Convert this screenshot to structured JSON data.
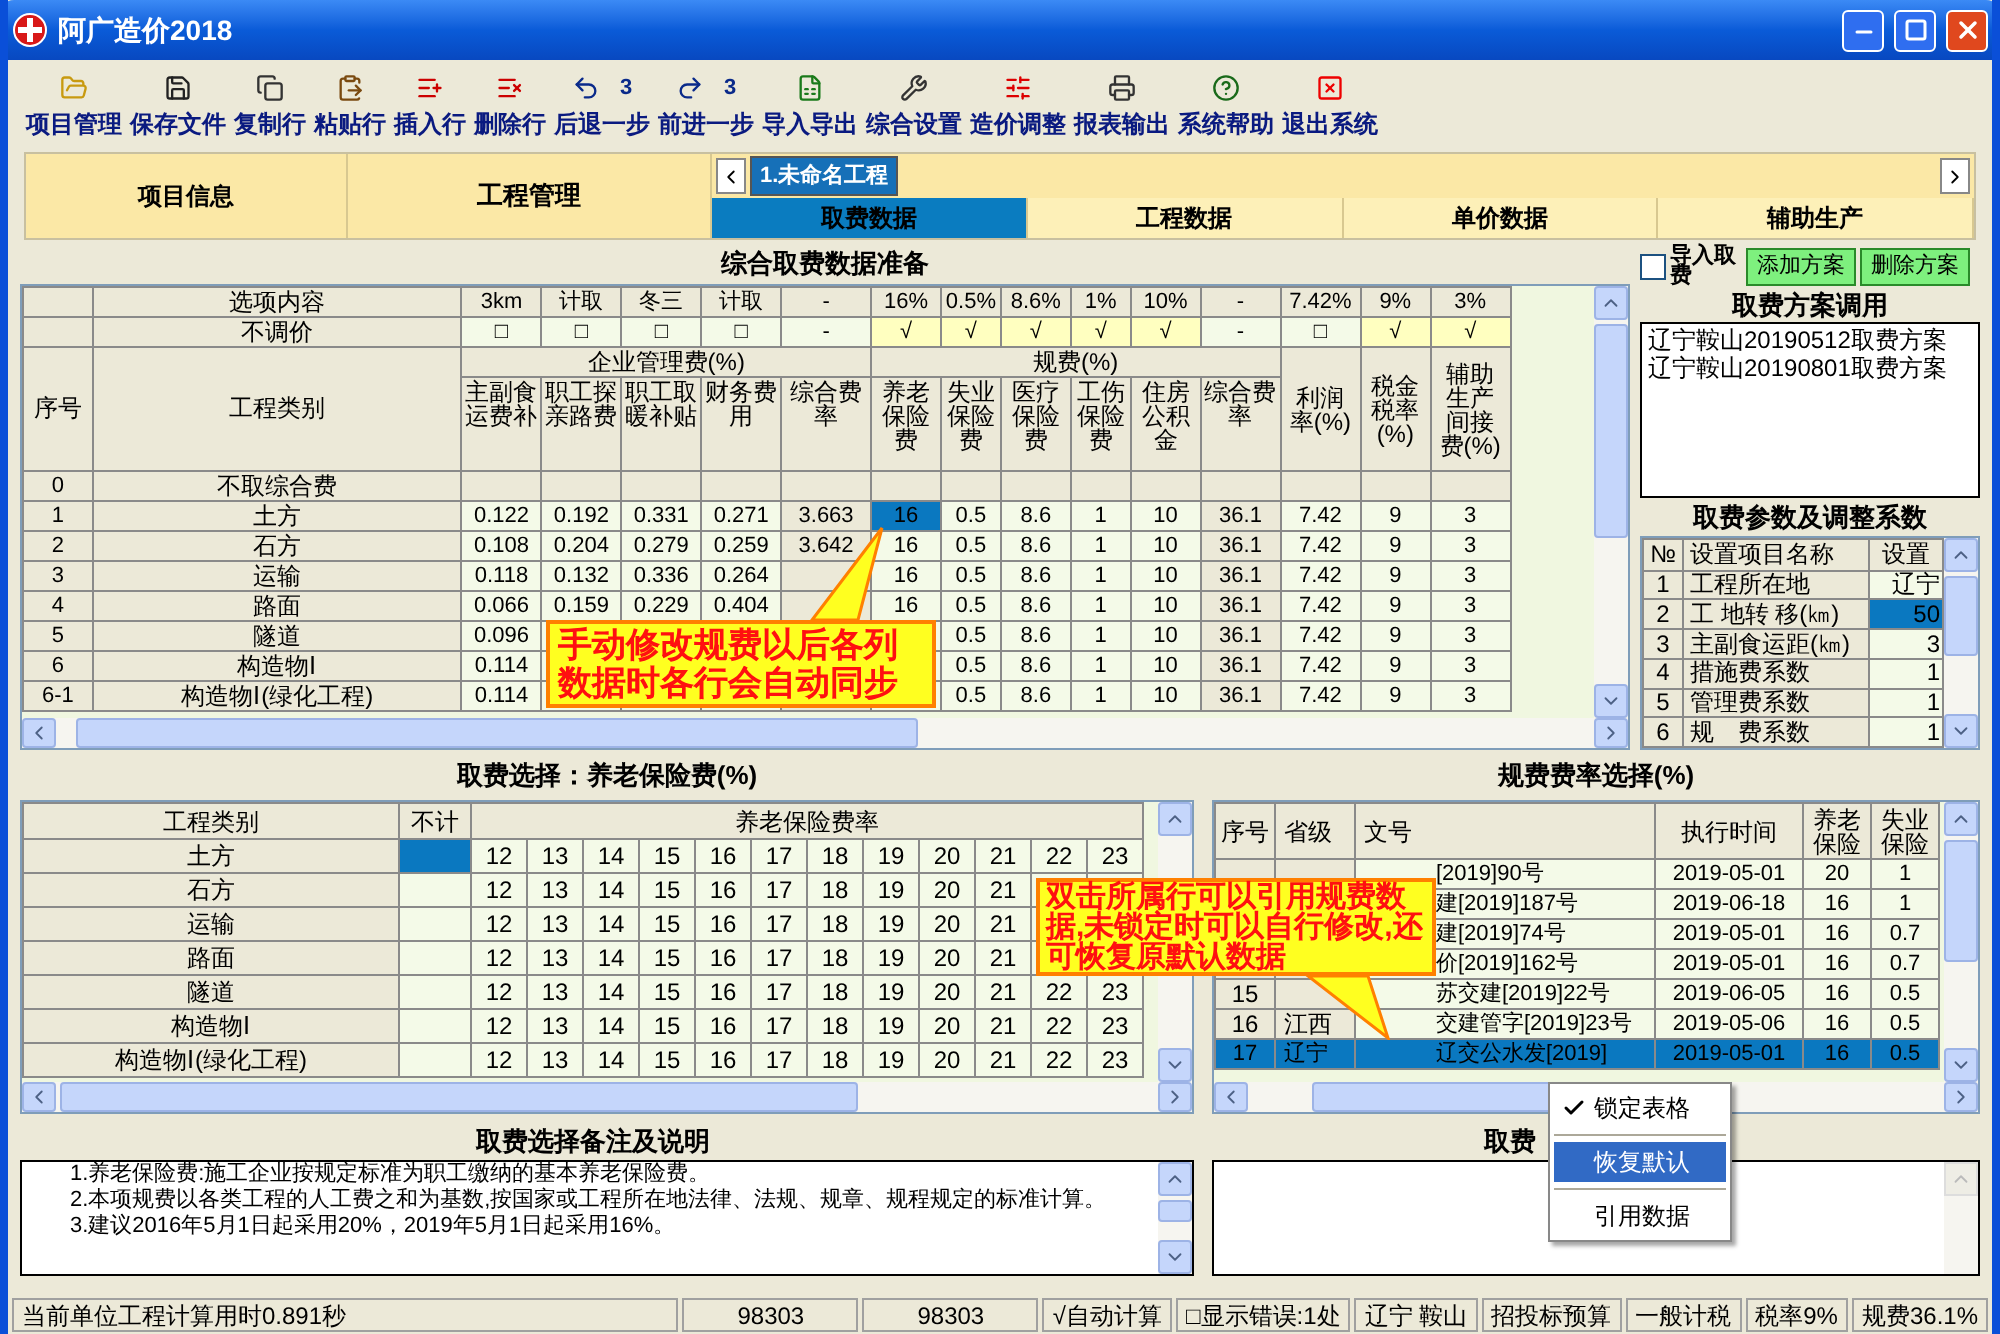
{
  "window": {
    "title": "阿广造价2018"
  },
  "toolbar": [
    {
      "label": "项目管理",
      "kind": "folder"
    },
    {
      "label": "保存文件",
      "kind": "save"
    },
    {
      "label": "复制行",
      "kind": "copy"
    },
    {
      "label": "粘贴行",
      "kind": "paste"
    },
    {
      "label": "插入行",
      "kind": "insert"
    },
    {
      "label": "删除行",
      "kind": "delete"
    },
    {
      "label": "后退一步",
      "kind": "undo",
      "count": "3"
    },
    {
      "label": "前进一步",
      "kind": "redo",
      "count": "3"
    },
    {
      "label": "导入导出",
      "kind": "import"
    },
    {
      "label": "综合设置",
      "kind": "settings"
    },
    {
      "label": "造价调整",
      "kind": "adjust"
    },
    {
      "label": "报表输出",
      "kind": "print"
    },
    {
      "label": "系统帮助",
      "kind": "help"
    },
    {
      "label": "退出系统",
      "kind": "exit"
    }
  ],
  "nav": {
    "project_info": "项目信息",
    "project_manage": "工程管理",
    "project_tabs": [
      {
        "label": "1.未命名工程",
        "selected": true
      }
    ],
    "tabs": [
      {
        "label": "取费数据",
        "selected": true
      },
      {
        "label": "工程数据",
        "selected": false
      },
      {
        "label": "单价数据",
        "selected": false
      },
      {
        "label": "辅助生产",
        "selected": false
      }
    ]
  },
  "fee_table": {
    "title": "综合取费数据准备",
    "option_label": "选项内容",
    "options": [
      "3km",
      "计取",
      "冬三",
      "计取",
      "-",
      "16%",
      "0.5%",
      "8.6%",
      "1%",
      "10%",
      "-",
      "7.42%",
      "9%",
      "3%"
    ],
    "adjust_label": "不调价",
    "adjust": [
      {
        "text": "□",
        "checked": false
      },
      {
        "text": "□",
        "checked": false
      },
      {
        "text": "□",
        "checked": false
      },
      {
        "text": "□",
        "checked": false
      },
      {
        "text": "-"
      },
      {
        "text": "√",
        "checked": true
      },
      {
        "text": "√",
        "checked": true
      },
      {
        "text": "√",
        "checked": true
      },
      {
        "text": "√",
        "checked": true
      },
      {
        "text": "√",
        "checked": true
      },
      {
        "text": "-"
      },
      {
        "text": "□",
        "checked": false
      },
      {
        "text": "√",
        "checked": true
      },
      {
        "text": "√",
        "checked": true
      }
    ],
    "no_label": "序号",
    "name_label": "工程类别",
    "groups": [
      {
        "label": "企业管理费(%)",
        "columns": [
          "主副食运费补",
          "职工探亲路费",
          "职工取暖补贴",
          "财务费用",
          "综合费率"
        ]
      },
      {
        "label": "规费(%)",
        "columns": [
          "养老保险费",
          "失业保险费",
          "医疗保险费",
          "工伤保险费",
          "住房公积金",
          "综合费率"
        ]
      }
    ],
    "extra_columns": [
      "利润率(%)",
      "税金税率(%)",
      "辅助生产间接费(%)"
    ],
    "rows": [
      {
        "no": "0",
        "name": "不取综合费",
        "cells": []
      },
      {
        "no": "1",
        "name": "土方",
        "cells": [
          "0.122",
          "0.192",
          "0.331",
          "0.271",
          "3.663",
          {
            "text": "16",
            "selected": true
          },
          "0.5",
          "8.6",
          "1",
          "10",
          "36.1",
          "7.42",
          "9",
          "3"
        ]
      },
      {
        "no": "2",
        "name": "石方",
        "cells": [
          "0.108",
          "0.204",
          "0.279",
          "0.259",
          "3.642",
          "16",
          "0.5",
          "8.6",
          "1",
          "10",
          "36.1",
          "7.42",
          "9",
          "3"
        ]
      },
      {
        "no": "3",
        "name": "运输",
        "cells": [
          "0.118",
          "0.132",
          "0.336",
          "0.264",
          null,
          "16",
          "0.5",
          "8.6",
          "1",
          "10",
          "36.1",
          "7.42",
          "9",
          "3"
        ]
      },
      {
        "no": "4",
        "name": "路面",
        "cells": [
          "0.066",
          "0.159",
          "0.229",
          "0.404",
          null,
          "16",
          "0.5",
          "8.6",
          "1",
          "10",
          "36.1",
          "7.42",
          "9",
          "3"
        ]
      },
      {
        "no": "5",
        "name": "隧道",
        "cells": [
          "0.096",
          null,
          null,
          null,
          null,
          null,
          "0.5",
          "8.6",
          "1",
          "10",
          "36.1",
          "7.42",
          "9",
          "3"
        ]
      },
      {
        "no": "6",
        "name": "构造物Ⅰ",
        "cells": [
          "0.114",
          null,
          null,
          null,
          null,
          null,
          "0.5",
          "8.6",
          "1",
          "10",
          "36.1",
          "7.42",
          "9",
          "3"
        ]
      },
      {
        "no": "6-1",
        "name": "构造物Ⅰ(绿化工程)",
        "cells": [
          "0.114",
          null,
          null,
          null,
          null,
          null,
          "0.5",
          "8.6",
          "1",
          "10",
          "36.1",
          "7.42",
          "9",
          "3"
        ]
      }
    ]
  },
  "side": {
    "import": {
      "label": "导入取费",
      "checked": false
    },
    "buttons": [
      "添加方案",
      "删除方案"
    ],
    "plans_title": "取费方案调用",
    "plans": [
      "辽宁鞍山20190512取费方案",
      "辽宁鞍山20190801取费方案"
    ],
    "params_title": "取费参数及调整系数",
    "params_columns": [
      "№",
      "设置项目名称",
      "设置"
    ],
    "params": [
      {
        "no": "1",
        "name": "工程所在地",
        "value": "辽宁",
        "selected": false
      },
      {
        "no": "2",
        "name": "工 地转 移(㎞)",
        "value": "50",
        "selected": true
      },
      {
        "no": "3",
        "name": "主副食运距(㎞)",
        "value": "3",
        "selected": false
      },
      {
        "no": "4",
        "name": "措施费系数",
        "value": "1",
        "selected": false
      },
      {
        "no": "5",
        "name": "管理费系数",
        "value": "1",
        "selected": false
      },
      {
        "no": "6",
        "name": "规　费系数",
        "value": "1",
        "selected": false
      }
    ]
  },
  "rate_select": {
    "title": "取费选择：养老保险费(%)",
    "columns": [
      "工程类别",
      "不计",
      "养老保险费率"
    ],
    "rows": [
      {
        "name": "土方",
        "selected": true,
        "values": [
          "12",
          "13",
          "14",
          "15",
          "16",
          "17",
          "18",
          "19",
          "20",
          "21",
          "22",
          "23"
        ]
      },
      {
        "name": "石方",
        "selected": false,
        "values": [
          "12",
          "13",
          "14",
          "15",
          "16",
          "17",
          "18",
          "19",
          "20",
          "21"
        ]
      },
      {
        "name": "运输",
        "selected": false,
        "values": [
          "12",
          "13",
          "14",
          "15",
          "16",
          "17",
          "18",
          "19",
          "20",
          "21"
        ]
      },
      {
        "name": "路面",
        "selected": false,
        "values": [
          "12",
          "13",
          "14",
          "15",
          "16",
          "17",
          "18",
          "19",
          "20",
          "21"
        ]
      },
      {
        "name": "隧道",
        "selected": false,
        "values": [
          "12",
          "13",
          "14",
          "15",
          "16",
          "17",
          "18",
          "19",
          "20",
          "21",
          "22",
          "23"
        ]
      },
      {
        "name": "构造物Ⅰ",
        "selected": false,
        "values": [
          "12",
          "13",
          "14",
          "15",
          "16",
          "17",
          "18",
          "19",
          "20",
          "21",
          "22",
          "23"
        ]
      },
      {
        "name": "构造物Ⅰ(绿化工程)",
        "selected": false,
        "values": [
          "12",
          "13",
          "14",
          "15",
          "16",
          "17",
          "18",
          "19",
          "20",
          "21",
          "22",
          "23"
        ]
      }
    ]
  },
  "regulation": {
    "title": "规费费率选择(%)",
    "columns": [
      "序号",
      "省级",
      "文号",
      "执行时间",
      "养老保险",
      "失业保险"
    ],
    "rows": [
      {
        "no": null,
        "province": null,
        "doc": "[2019]90号",
        "date": "2019-05-01",
        "pension": "20",
        "unemployment": "1",
        "selected": false
      },
      {
        "no": null,
        "province": null,
        "doc": "建[2019]187号",
        "date": "2019-06-18",
        "pension": "16",
        "unemployment": "1",
        "selected": false
      },
      {
        "no": null,
        "province": null,
        "doc": "建[2019]74号",
        "date": "2019-05-01",
        "pension": "16",
        "unemployment": "0.7",
        "selected": false
      },
      {
        "no": null,
        "province": null,
        "doc": "价[2019]162号",
        "date": "2019-05-01",
        "pension": "16",
        "unemployment": "0.7",
        "selected": false
      },
      {
        "no": "15",
        "province": null,
        "doc": "苏交建[2019]22号",
        "date": "2019-06-05",
        "pension": "16",
        "unemployment": "0.5",
        "selected": false
      },
      {
        "no": "16",
        "province": "江西",
        "doc": "交建管字[2019]23号",
        "date": "2019-05-06",
        "pension": "16",
        "unemployment": "0.5",
        "selected": false
      },
      {
        "no": "17",
        "province": "辽宁",
        "doc": "辽交公水发[2019]",
        "date": "2019-05-01",
        "pension": "16",
        "unemployment": "0.5",
        "selected": true
      }
    ]
  },
  "callouts": [
    {
      "text": "手动修改规费以后各列数据时各行会自动同步"
    },
    {
      "text": "双击所属行可以引用规费数据,未锁定时可以自行修改,还可恢复原默认数据"
    }
  ],
  "context_menu": [
    {
      "label": "锁定表格",
      "checked": true,
      "selected": false
    },
    {
      "label": "恢复默认",
      "checked": false,
      "selected": true
    },
    {
      "label": "引用数据",
      "checked": false,
      "selected": false
    }
  ],
  "notes": {
    "title": "取费选择备注及说明",
    "lines": [
      "1.养老保险费:施工企业按规定标准为职工缴纳的基本养老保险费。",
      "2.本项规费以各类工程的人工费之和为基数,按国家或工程所在地法律、法规、规章、规程规定的标准计算。",
      "3.建议2016年5月1日起采用20%，2019年5月1日起采用16%。"
    ],
    "right_title": "取费"
  },
  "status_bar": [
    "当前单位工程计算用时0.891秒",
    "98303",
    "98303",
    "√自动计算",
    "□显示错误:1处",
    "辽宁 鞍山",
    "招投标预算",
    "一般计税",
    "税率9%",
    "规费36.1%"
  ]
}
